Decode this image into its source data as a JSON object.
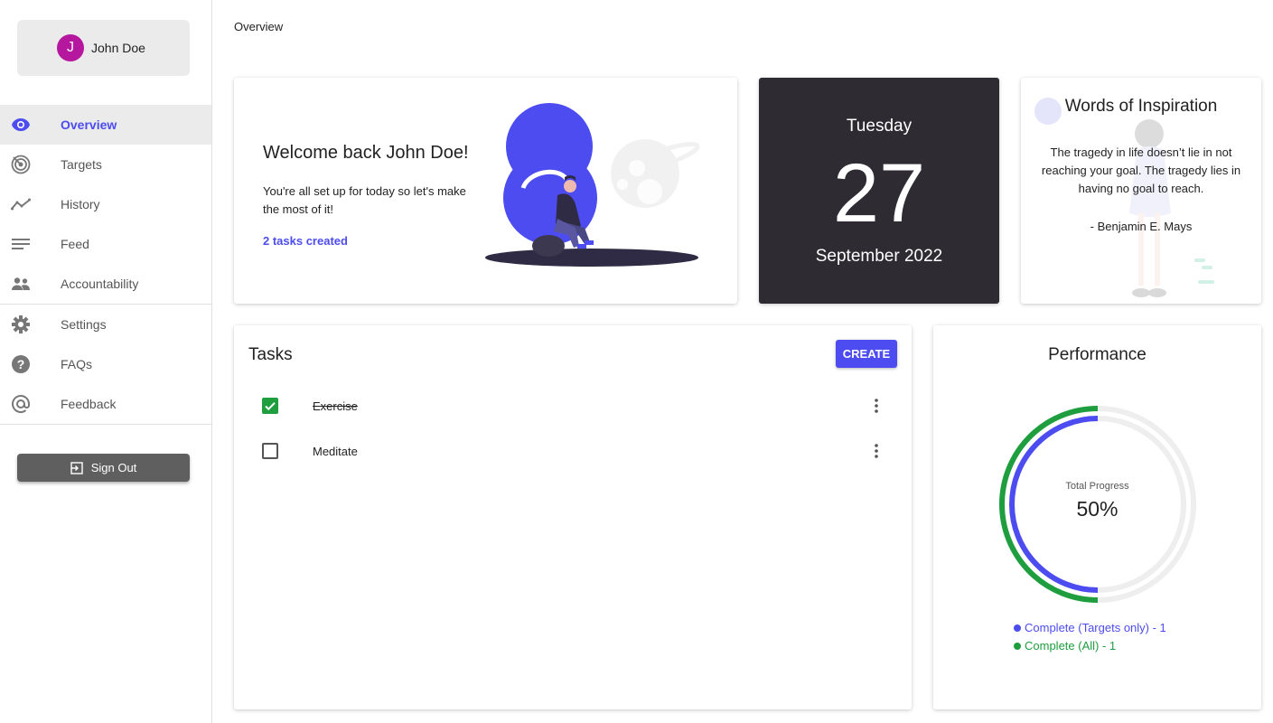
{
  "profile": {
    "initial": "J",
    "name": "John Doe"
  },
  "nav": {
    "items": [
      {
        "label": "Overview",
        "icon": "eye-icon",
        "active": true
      },
      {
        "label": "Targets",
        "icon": "target-icon"
      },
      {
        "label": "History",
        "icon": "trend-icon"
      },
      {
        "label": "Feed",
        "icon": "feed-icon"
      },
      {
        "label": "Accountability",
        "icon": "people-icon"
      },
      {
        "label": "Settings",
        "icon": "gear-icon"
      },
      {
        "label": "FAQs",
        "icon": "help-icon"
      },
      {
        "label": "Feedback",
        "icon": "at-icon"
      }
    ],
    "signout_label": "Sign Out"
  },
  "page_title": "Overview",
  "welcome": {
    "heading": "Welcome back John Doe!",
    "message": "You're all set up for today so let's make the most of it!",
    "tasks_link": "2 tasks created"
  },
  "date": {
    "weekday": "Tuesday",
    "day": "27",
    "month_year": "September 2022"
  },
  "quote": {
    "title": "Words of Inspiration",
    "text": "The tragedy in life doesn’t lie in not reaching your goal. The tragedy lies in having no goal to reach.",
    "author": "- Benjamin E. Mays"
  },
  "tasks": {
    "title": "Tasks",
    "create_label": "CREATE",
    "items": [
      {
        "label": "Exercise",
        "done": true
      },
      {
        "label": "Meditate",
        "done": false
      }
    ]
  },
  "performance": {
    "title": "Performance",
    "center_label": "Total Progress",
    "center_value": "50%",
    "legend": [
      {
        "label": "Complete (Targets only) - 1",
        "color": "#4c4cf0"
      },
      {
        "label": "Complete (All) - 1",
        "color": "#1e9e3e"
      }
    ],
    "fractions": [
      0.5,
      0.5
    ]
  },
  "colors": {
    "accent": "#4c4cf0",
    "success": "#1e9e3e",
    "avatar": "#b5179e",
    "date_bg": "#2f2b33"
  }
}
